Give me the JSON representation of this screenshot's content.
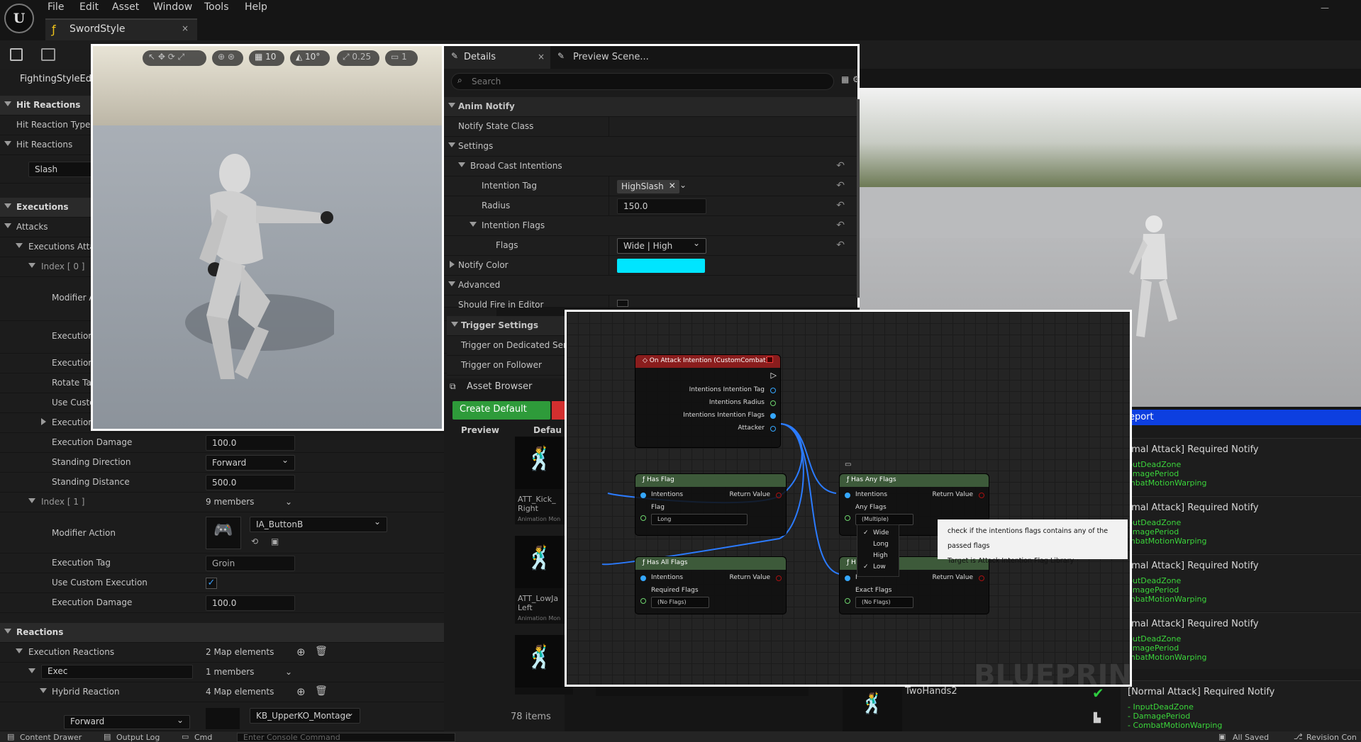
{
  "menu": [
    "File",
    "Edit",
    "Asset",
    "Window",
    "Tools",
    "Help"
  ],
  "asset_tab": {
    "title": "SwordStyle",
    "close": "×"
  },
  "left": {
    "tab": "FightingStyleEdit",
    "hit_reactions_section": "Hit Reactions",
    "hit_reaction_type": "Hit Reaction Type",
    "hit_reactions": "Hit Reactions",
    "slash": "Slash",
    "executions_section": "Executions",
    "attacks": "Attacks",
    "executions_attack": "Executions Attac",
    "index0": "Index [ 0 ]",
    "modifier_a": "Modifier A",
    "execution1": "Execution",
    "execution2": "Execution",
    "rotate": "Rotate Tar",
    "use_custo": "Use Custo",
    "execution3": "Execution",
    "execution_damage": "Execution Damage",
    "execution_damage_val": "100.0",
    "standing_direction": "Standing Direction",
    "standing_direction_val": "Forward",
    "standing_distance": "Standing Distance",
    "standing_distance_val": "500.0",
    "index1": "Index [ 1 ]",
    "index1_members": "9 members",
    "modifier_action": "Modifier Action",
    "modifier_action_val": "IA_ButtonB",
    "execution_tag": "Execution Tag",
    "execution_tag_val": "Groin",
    "use_custom_execution": "Use Custom Execution",
    "execution_damage2": "Execution Damage",
    "execution_damage2_val": "100.0",
    "reactions": "Reactions",
    "execution_reactions": "Execution Reactions",
    "execution_reactions_val": "2 Map elements",
    "exec": "Exec",
    "exec_val": "1 members",
    "hybrid_reaction": "Hybrid Reaction",
    "hybrid_reaction_val": "4 Map elements",
    "forward": "Forward",
    "montage": "KB_UpperKO_Montage"
  },
  "viewport": {
    "grid": "10",
    "angle": "10°",
    "scale": "0.25",
    "cam": "1"
  },
  "details": {
    "tab": "Details",
    "tab2": "Preview Scene...",
    "search_placeholder": "Search",
    "anim_notify": "Anim Notify",
    "notify_state_class": "Notify State Class",
    "settings": "Settings",
    "broad_cast": "Broad Cast Intentions",
    "intention_tag": "Intention Tag",
    "intention_tag_val": "HighSlash",
    "radius": "Radius",
    "radius_val": "150.0",
    "intention_flags": "Intention Flags",
    "flags": "Flags",
    "flags_val": "Wide | High",
    "notify_color": "Notify Color",
    "notify_color_hex": "#00e5ff",
    "advanced": "Advanced",
    "should_fire": "Should Fire in Editor",
    "trigger_settings": "Trigger Settings",
    "trigger_dedicated": "Trigger on Dedicated Serve",
    "trigger_follower": "Trigger on Follower"
  },
  "asset_browser": {
    "title": "Asset Browser",
    "create": "Create Default",
    "preview": "Preview",
    "defau": "Defau",
    "item1": "ATT_Kick_ Right",
    "item1_sub": "Animation Mon",
    "item2": "ATT_LowJa Left",
    "item2_sub": "Animation Mon",
    "count": "78 items",
    "twohands": "TwoHands2"
  },
  "blueprint": {
    "watermark": "BLUEPRINT",
    "event": {
      "title": "On Attack Intention (CustomCombat)",
      "pins": [
        "Intentions Intention Tag",
        "Intentions Radius",
        "Intentions Intention Flags",
        "Attacker"
      ]
    },
    "has_flag": {
      "title": "Has Flag",
      "in": "Intentions",
      "out": "Return Value",
      "sub": "Flag",
      "sub_val": "Long"
    },
    "has_any": {
      "title": "Has Any Flags",
      "in": "Intentions",
      "out": "Return Value",
      "sub": "Any Flags",
      "sub_val": "(Multiple)"
    },
    "has_all": {
      "title": "Has All Flags",
      "in": "Intentions",
      "out": "Return Value",
      "sub": "Required Flags",
      "sub_val": "(No Flags)"
    },
    "has_exact": {
      "title": "H",
      "in": "I",
      "out": "Return Value",
      "sub": "Exact Flags",
      "sub_val": "(No Flags)"
    },
    "menu": [
      "Wide",
      "Long",
      "High",
      "Low"
    ],
    "tooltip": [
      "check if the intentions flags contains any of the passed flags",
      "Target is Attack Intention Flag Library"
    ]
  },
  "log": {
    "title": "eport",
    "entries": [
      {
        "h": "rmal Attack] Required Notify",
        "g": [
          "putDeadZone",
          "amagePeriod",
          "mbatMotionWarping"
        ]
      },
      {
        "h": "rmal Attack] Required Notify",
        "g": [
          "putDeadZone",
          "amagePeriod",
          "mbatMotionWarping"
        ]
      },
      {
        "h": "rmal Attack] Required Notify",
        "g": [
          "putDeadZone",
          "amagePeriod",
          "mbatMotionWarping"
        ]
      },
      {
        "h": "rmal Attack] Required Notify",
        "g": [
          "putDeadZone",
          "amagePeriod",
          "mbatMotionWarping"
        ]
      },
      {
        "h": "[Normal Attack] Required Notify",
        "g": [
          "- InputDeadZone",
          "- DamagePeriod",
          "- CombatMotionWarping"
        ]
      }
    ]
  },
  "bottom": {
    "content_drawer": "Content Drawer",
    "output_log": "Output Log",
    "cmd": "Cmd",
    "console_placeholder": "Enter Console Command",
    "all_saved": "All Saved",
    "revision": "Revision Con"
  }
}
